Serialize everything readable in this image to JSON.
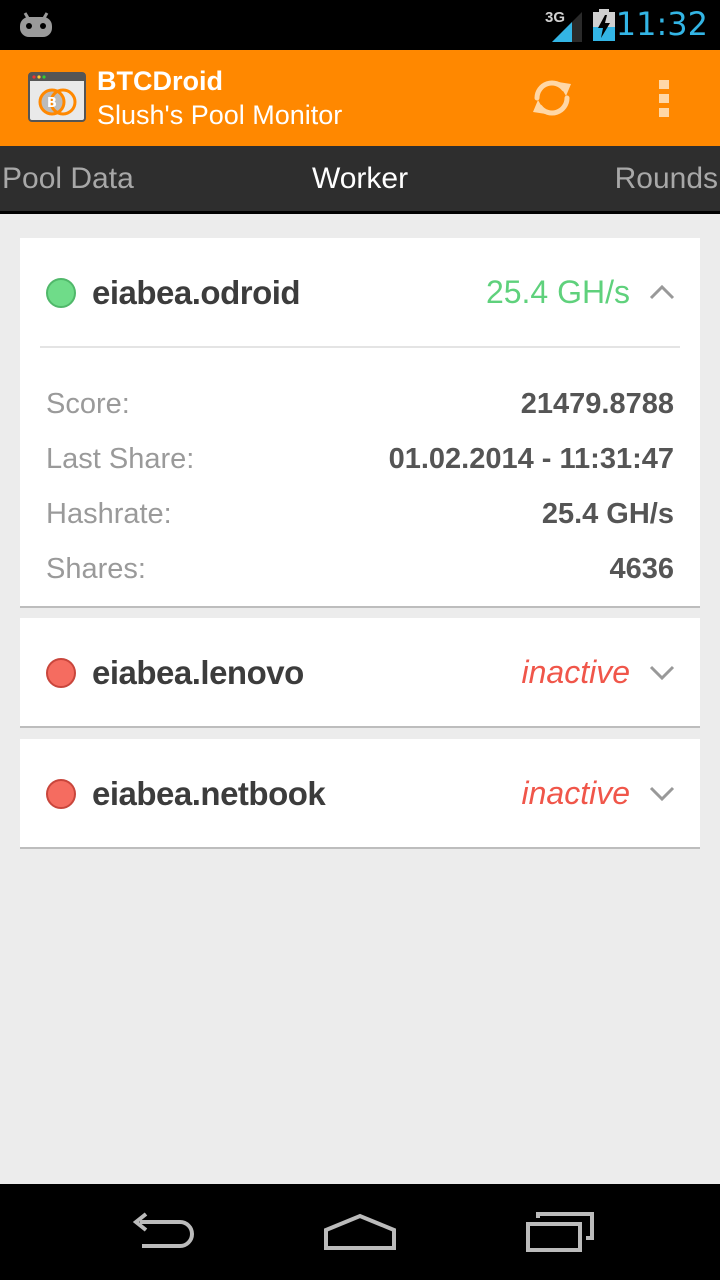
{
  "status_bar": {
    "network": "3G",
    "clock": "11:32"
  },
  "action_bar": {
    "title": "BTCDroid",
    "subtitle": "Slush's Pool Monitor",
    "accent_color": "#ff8800"
  },
  "tabs": [
    {
      "label": "Pool Data"
    },
    {
      "label": "Worker"
    },
    {
      "label": "Rounds"
    }
  ],
  "workers": [
    {
      "name": "eiabea.odroid",
      "status": "25.4 GH/s",
      "state": "active",
      "expanded": true,
      "details": [
        {
          "label": "Score:",
          "value": "21479.8788"
        },
        {
          "label": "Last Share:",
          "value": "01.02.2014 - 11:31:47"
        },
        {
          "label": "Hashrate:",
          "value": "25.4 GH/s"
        },
        {
          "label": "Shares:",
          "value": "4636"
        }
      ]
    },
    {
      "name": "eiabea.lenovo",
      "status": "inactive",
      "state": "inactive",
      "expanded": false
    },
    {
      "name": "eiabea.netbook",
      "status": "inactive",
      "state": "inactive",
      "expanded": false
    }
  ],
  "colors": {
    "active": "#5fd17c",
    "inactive": "#f0564a"
  }
}
